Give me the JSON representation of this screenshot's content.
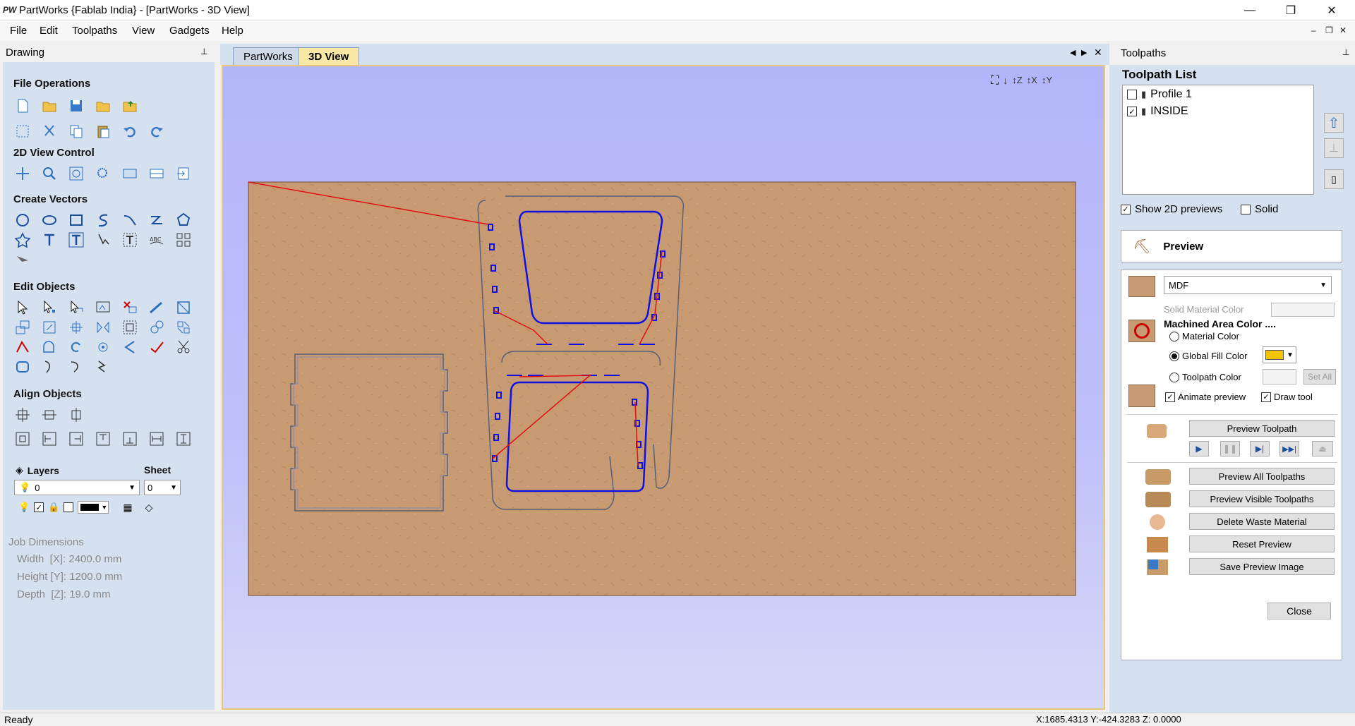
{
  "window": {
    "logo": "PW",
    "title": "PartWorks {Fablab India} - [PartWorks - 3D View]",
    "minimize": "—",
    "restore": "❐",
    "close": "✕"
  },
  "menu": [
    "File",
    "Edit",
    "Toolpaths",
    "View",
    "Gadgets",
    "Help"
  ],
  "mdi_controls": [
    "‒",
    "❐",
    "✕"
  ],
  "drawing_panel": {
    "title": "Drawing",
    "pin": "📌",
    "sections": {
      "file_ops": "File Operations",
      "view_control": "2D View Control",
      "create_vectors": "Create Vectors",
      "edit_objects": "Edit Objects",
      "align_objects": "Align Objects"
    },
    "layers_label": "Layers",
    "sheet_label": "Sheet",
    "layer_value": "0",
    "sheet_value": "0",
    "job_dimensions": {
      "title": "Job Dimensions",
      "width": "Width  [X]: 2400.0 mm",
      "height": "Height [Y]: 1200.0 mm",
      "depth": "Depth  [Z]: 19.0 mm"
    }
  },
  "tabs": {
    "partworks": "PartWorks",
    "view3d": "3D View"
  },
  "toolpaths_panel": {
    "title": "Toolpaths",
    "list_title": "Toolpath List",
    "items": [
      {
        "name": "Profile 1",
        "checked": false
      },
      {
        "name": "INSIDE",
        "checked": true
      }
    ],
    "show_2d": "Show 2D previews",
    "solid": "Solid",
    "preview_title": "Preview",
    "material": "MDF",
    "solid_material_color": "Solid Material Color",
    "machined_area_color": "Machined Area Color ....",
    "material_color": "Material Color",
    "global_fill_color": "Global Fill Color",
    "toolpath_color": "Toolpath Color",
    "set_all": "Set All",
    "animate_preview": "Animate preview",
    "draw_tool": "Draw tool",
    "preview_toolpath": "Preview Toolpath",
    "preview_all": "Preview All Toolpaths",
    "preview_visible": "Preview Visible Toolpaths",
    "delete_waste": "Delete Waste Material",
    "reset_preview": "Reset Preview",
    "save_preview": "Save Preview Image",
    "close": "Close",
    "fill_color": "#f5c400"
  },
  "status": {
    "left": "Ready",
    "coords": "X:1685.4313 Y:-424.3283 Z: 0.0000"
  },
  "colors": {
    "panel_bg": "#d6e1ef",
    "board": "#c9986e",
    "toolpath_blue": "#1010e0",
    "toolpath_red": "#e01010"
  }
}
